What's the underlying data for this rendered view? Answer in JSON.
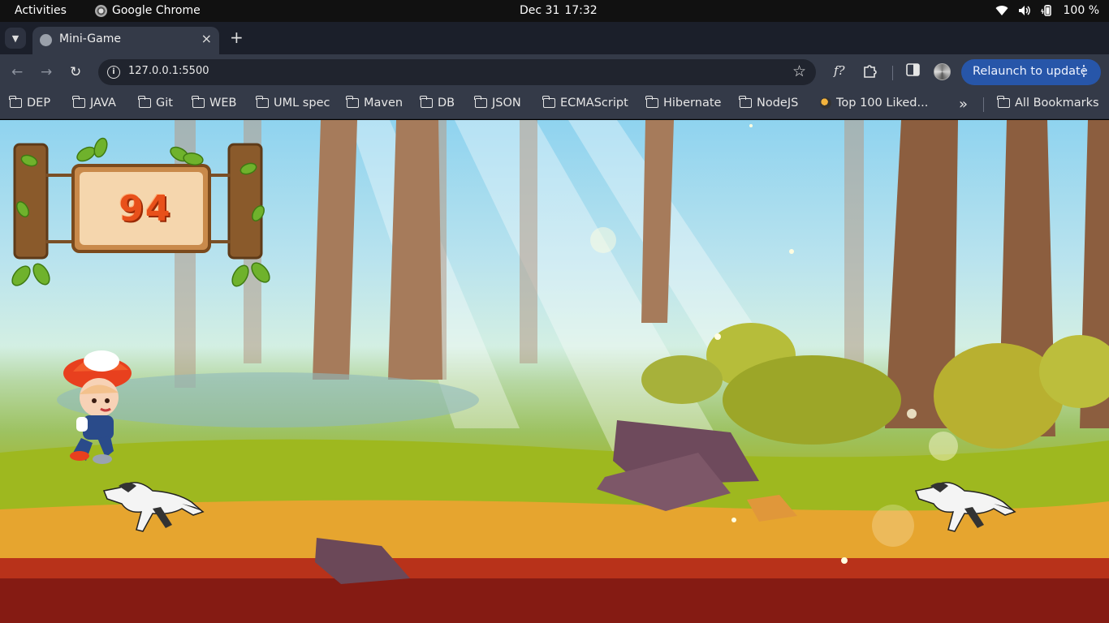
{
  "topbar": {
    "activities": "Activities",
    "app_name": "Google Chrome",
    "date": "Dec 31",
    "time": "17:32",
    "battery": "100 %"
  },
  "tab": {
    "title": "Mini-Game",
    "close": "×",
    "new_tab": "+"
  },
  "toolbar": {
    "url": "127.0.0.1:5500",
    "relaunch_label": "Relaunch to update",
    "ext_label": "f?"
  },
  "bookmarks": {
    "items": [
      {
        "label": "DEP"
      },
      {
        "label": "JAVA"
      },
      {
        "label": "Git"
      },
      {
        "label": "WEB"
      },
      {
        "label": "UML spec"
      },
      {
        "label": "Maven"
      },
      {
        "label": "DB"
      },
      {
        "label": "JSON"
      },
      {
        "label": "ECMAScript"
      },
      {
        "label": "Hibernate"
      },
      {
        "label": "NodeJS"
      },
      {
        "label": "Top 100 Liked..."
      }
    ],
    "more": "»",
    "all_bookmarks": "All Bookmarks"
  },
  "game": {
    "score": "94",
    "accent_colors": {
      "score": "#e8501a",
      "sky": "#8fd3ef",
      "grass": "#a6b52b",
      "ground": "#e6a233",
      "lava": "#8e1d16"
    }
  }
}
